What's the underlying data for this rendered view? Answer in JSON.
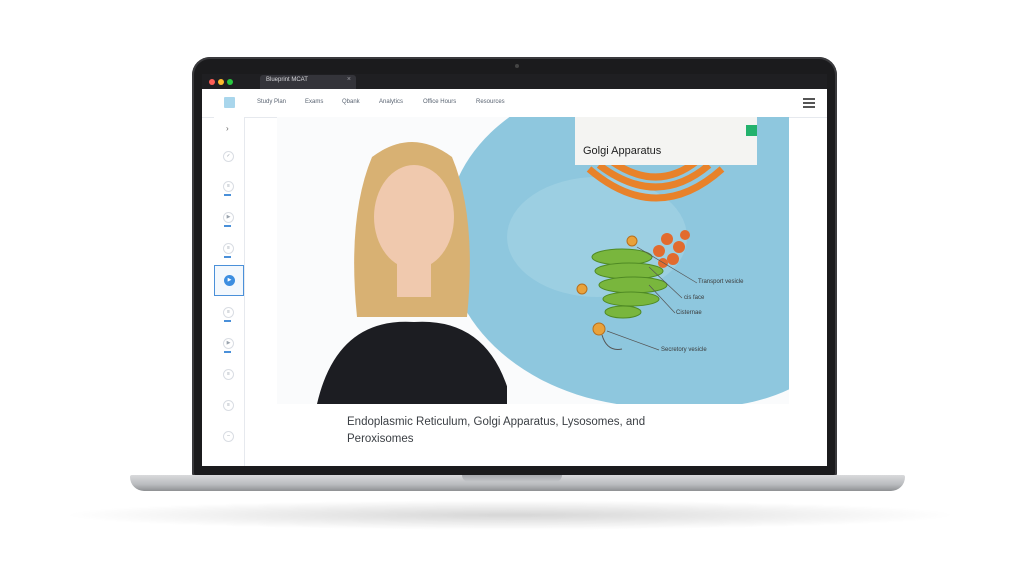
{
  "browser": {
    "tab_title": "Blueprint MCAT",
    "tab_close": "×"
  },
  "nav": {
    "items": [
      {
        "label": "Study Plan"
      },
      {
        "label": "Exams"
      },
      {
        "label": "Qbank"
      },
      {
        "label": "Analytics"
      },
      {
        "label": "Office Hours"
      },
      {
        "label": "Resources"
      }
    ]
  },
  "sidebar": {
    "expand_glyph": "›"
  },
  "slide": {
    "card_title": "Golgi Apparatus",
    "labels": {
      "transport_vesicle": "Transport vesicle",
      "cis_face": "cis face",
      "cisternae": "Cisternae",
      "secretory_vesicle": "Secretory vesicle"
    }
  },
  "lesson": {
    "title": "Endoplasmic Reticulum, Golgi Apparatus, Lysosomes, and Peroxisomes"
  },
  "colors": {
    "accent": "#3d8ee0",
    "card_badge": "#23b26d",
    "cell": "#8ec7de"
  }
}
